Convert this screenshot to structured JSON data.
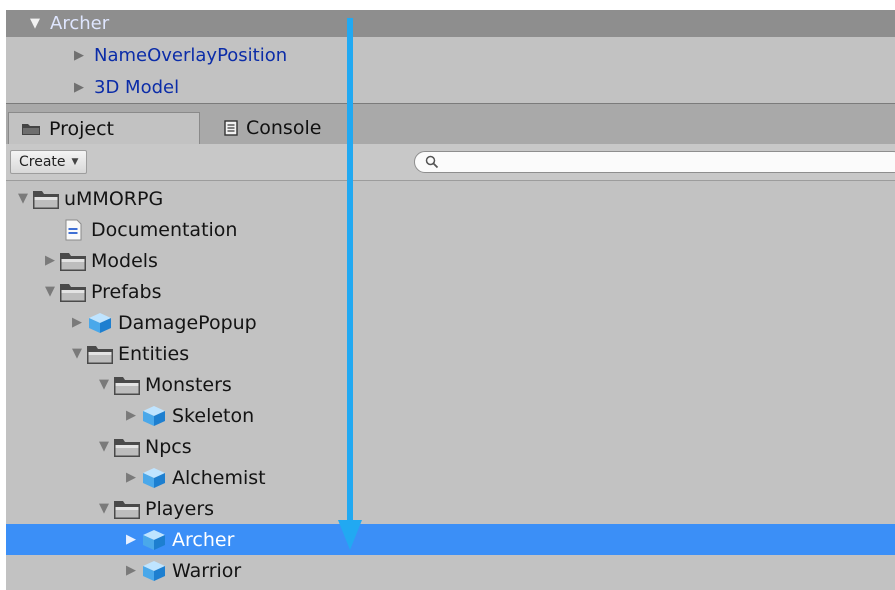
{
  "hierarchy": {
    "items": [
      {
        "label": "Archer",
        "selected": true
      },
      {
        "label": "NameOverlayPosition"
      },
      {
        "label": "3D Model"
      }
    ]
  },
  "tabs": [
    {
      "label": "Project",
      "icon": "folder-icon",
      "active": true
    },
    {
      "label": "Console",
      "icon": "console-icon",
      "active": false
    }
  ],
  "toolbar": {
    "create_label": "Create",
    "search_value": "",
    "search_icon": "magnifier-icon"
  },
  "tree": [
    {
      "label": "uMMORPG",
      "depth": 0,
      "icon": "folder",
      "state": "expanded"
    },
    {
      "label": "Documentation",
      "depth": 1,
      "icon": "document",
      "state": "leaf"
    },
    {
      "label": "Models",
      "depth": 1,
      "icon": "folder",
      "state": "collapsed"
    },
    {
      "label": "Prefabs",
      "depth": 1,
      "icon": "folder",
      "state": "expanded"
    },
    {
      "label": "DamagePopup",
      "depth": 2,
      "icon": "prefab",
      "state": "collapsed"
    },
    {
      "label": "Entities",
      "depth": 2,
      "icon": "folder",
      "state": "expanded"
    },
    {
      "label": "Monsters",
      "depth": 3,
      "icon": "folder",
      "state": "expanded"
    },
    {
      "label": "Skeleton",
      "depth": 4,
      "icon": "prefab",
      "state": "collapsed"
    },
    {
      "label": "Npcs",
      "depth": 3,
      "icon": "folder",
      "state": "expanded"
    },
    {
      "label": "Alchemist",
      "depth": 4,
      "icon": "prefab",
      "state": "collapsed"
    },
    {
      "label": "Players",
      "depth": 3,
      "icon": "folder",
      "state": "expanded"
    },
    {
      "label": "Archer",
      "depth": 4,
      "icon": "prefab",
      "state": "collapsed",
      "selected": true
    },
    {
      "label": "Warrior",
      "depth": 4,
      "icon": "prefab",
      "state": "collapsed"
    }
  ],
  "colors": {
    "selection": "#3b8ff7",
    "arrow": "#21a9f2",
    "hierarchy_text": "#0b2ca8"
  }
}
